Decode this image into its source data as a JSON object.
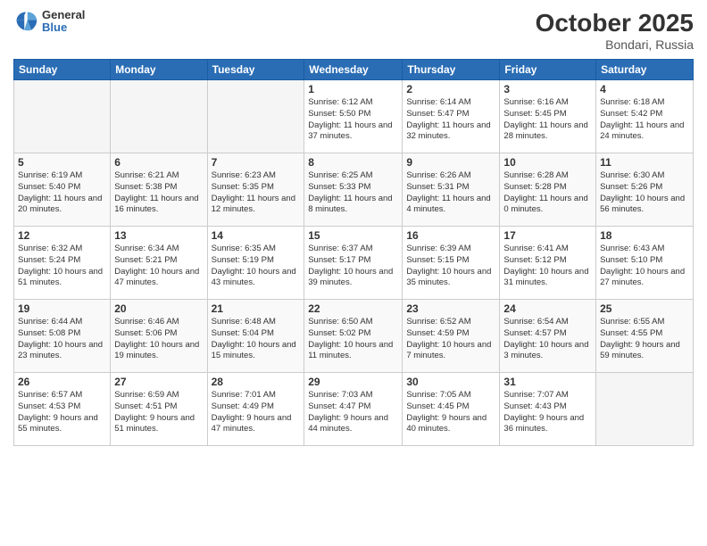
{
  "header": {
    "logo": {
      "general": "General",
      "blue": "Blue"
    },
    "title": "October 2025",
    "location": "Bondari, Russia"
  },
  "days_of_week": [
    "Sunday",
    "Monday",
    "Tuesday",
    "Wednesday",
    "Thursday",
    "Friday",
    "Saturday"
  ],
  "weeks": [
    [
      {
        "day": "",
        "info": ""
      },
      {
        "day": "",
        "info": ""
      },
      {
        "day": "",
        "info": ""
      },
      {
        "day": "1",
        "info": "Sunrise: 6:12 AM\nSunset: 5:50 PM\nDaylight: 11 hours\nand 37 minutes."
      },
      {
        "day": "2",
        "info": "Sunrise: 6:14 AM\nSunset: 5:47 PM\nDaylight: 11 hours\nand 32 minutes."
      },
      {
        "day": "3",
        "info": "Sunrise: 6:16 AM\nSunset: 5:45 PM\nDaylight: 11 hours\nand 28 minutes."
      },
      {
        "day": "4",
        "info": "Sunrise: 6:18 AM\nSunset: 5:42 PM\nDaylight: 11 hours\nand 24 minutes."
      }
    ],
    [
      {
        "day": "5",
        "info": "Sunrise: 6:19 AM\nSunset: 5:40 PM\nDaylight: 11 hours\nand 20 minutes."
      },
      {
        "day": "6",
        "info": "Sunrise: 6:21 AM\nSunset: 5:38 PM\nDaylight: 11 hours\nand 16 minutes."
      },
      {
        "day": "7",
        "info": "Sunrise: 6:23 AM\nSunset: 5:35 PM\nDaylight: 11 hours\nand 12 minutes."
      },
      {
        "day": "8",
        "info": "Sunrise: 6:25 AM\nSunset: 5:33 PM\nDaylight: 11 hours\nand 8 minutes."
      },
      {
        "day": "9",
        "info": "Sunrise: 6:26 AM\nSunset: 5:31 PM\nDaylight: 11 hours\nand 4 minutes."
      },
      {
        "day": "10",
        "info": "Sunrise: 6:28 AM\nSunset: 5:28 PM\nDaylight: 11 hours\nand 0 minutes."
      },
      {
        "day": "11",
        "info": "Sunrise: 6:30 AM\nSunset: 5:26 PM\nDaylight: 10 hours\nand 56 minutes."
      }
    ],
    [
      {
        "day": "12",
        "info": "Sunrise: 6:32 AM\nSunset: 5:24 PM\nDaylight: 10 hours\nand 51 minutes."
      },
      {
        "day": "13",
        "info": "Sunrise: 6:34 AM\nSunset: 5:21 PM\nDaylight: 10 hours\nand 47 minutes."
      },
      {
        "day": "14",
        "info": "Sunrise: 6:35 AM\nSunset: 5:19 PM\nDaylight: 10 hours\nand 43 minutes."
      },
      {
        "day": "15",
        "info": "Sunrise: 6:37 AM\nSunset: 5:17 PM\nDaylight: 10 hours\nand 39 minutes."
      },
      {
        "day": "16",
        "info": "Sunrise: 6:39 AM\nSunset: 5:15 PM\nDaylight: 10 hours\nand 35 minutes."
      },
      {
        "day": "17",
        "info": "Sunrise: 6:41 AM\nSunset: 5:12 PM\nDaylight: 10 hours\nand 31 minutes."
      },
      {
        "day": "18",
        "info": "Sunrise: 6:43 AM\nSunset: 5:10 PM\nDaylight: 10 hours\nand 27 minutes."
      }
    ],
    [
      {
        "day": "19",
        "info": "Sunrise: 6:44 AM\nSunset: 5:08 PM\nDaylight: 10 hours\nand 23 minutes."
      },
      {
        "day": "20",
        "info": "Sunrise: 6:46 AM\nSunset: 5:06 PM\nDaylight: 10 hours\nand 19 minutes."
      },
      {
        "day": "21",
        "info": "Sunrise: 6:48 AM\nSunset: 5:04 PM\nDaylight: 10 hours\nand 15 minutes."
      },
      {
        "day": "22",
        "info": "Sunrise: 6:50 AM\nSunset: 5:02 PM\nDaylight: 10 hours\nand 11 minutes."
      },
      {
        "day": "23",
        "info": "Sunrise: 6:52 AM\nSunset: 4:59 PM\nDaylight: 10 hours\nand 7 minutes."
      },
      {
        "day": "24",
        "info": "Sunrise: 6:54 AM\nSunset: 4:57 PM\nDaylight: 10 hours\nand 3 minutes."
      },
      {
        "day": "25",
        "info": "Sunrise: 6:55 AM\nSunset: 4:55 PM\nDaylight: 9 hours\nand 59 minutes."
      }
    ],
    [
      {
        "day": "26",
        "info": "Sunrise: 6:57 AM\nSunset: 4:53 PM\nDaylight: 9 hours\nand 55 minutes."
      },
      {
        "day": "27",
        "info": "Sunrise: 6:59 AM\nSunset: 4:51 PM\nDaylight: 9 hours\nand 51 minutes."
      },
      {
        "day": "28",
        "info": "Sunrise: 7:01 AM\nSunset: 4:49 PM\nDaylight: 9 hours\nand 47 minutes."
      },
      {
        "day": "29",
        "info": "Sunrise: 7:03 AM\nSunset: 4:47 PM\nDaylight: 9 hours\nand 44 minutes."
      },
      {
        "day": "30",
        "info": "Sunrise: 7:05 AM\nSunset: 4:45 PM\nDaylight: 9 hours\nand 40 minutes."
      },
      {
        "day": "31",
        "info": "Sunrise: 7:07 AM\nSunset: 4:43 PM\nDaylight: 9 hours\nand 36 minutes."
      },
      {
        "day": "",
        "info": ""
      }
    ]
  ]
}
